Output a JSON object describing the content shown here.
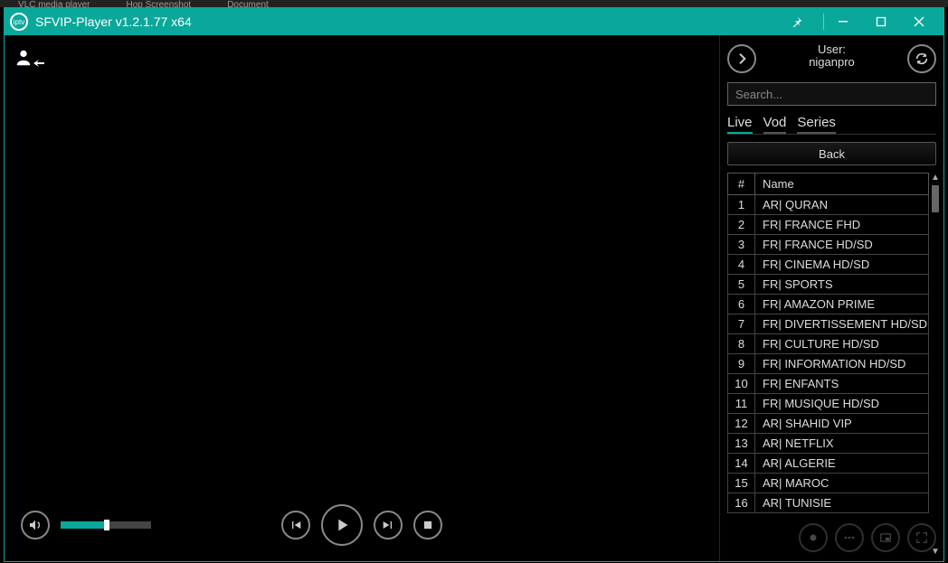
{
  "taskbar": {
    "items": [
      "VLC media player",
      "Hop Screenshot",
      "Document"
    ]
  },
  "window": {
    "title": "SFVIP-Player v1.2.1.77 x64"
  },
  "user": {
    "label": "User:",
    "name": "niganpro"
  },
  "search": {
    "placeholder": "Search..."
  },
  "tabs": {
    "live": "Live",
    "vod": "Vod",
    "series": "Series",
    "active": "live"
  },
  "back_label": "Back",
  "list": {
    "header_num": "#",
    "header_name": "Name",
    "rows": [
      {
        "n": "1",
        "name": "AR| QURAN"
      },
      {
        "n": "2",
        "name": "FR| FRANCE FHD"
      },
      {
        "n": "3",
        "name": "FR| FRANCE HD/SD"
      },
      {
        "n": "4",
        "name": "FR| CINEMA HD/SD"
      },
      {
        "n": "5",
        "name": "FR| SPORTS"
      },
      {
        "n": "6",
        "name": "FR| AMAZON PRIME"
      },
      {
        "n": "7",
        "name": "FR| DIVERTISSEMENT HD/SD"
      },
      {
        "n": "8",
        "name": "FR| CULTURE HD/SD"
      },
      {
        "n": "9",
        "name": "FR| INFORMATION HD/SD"
      },
      {
        "n": "10",
        "name": "FR| ENFANTS"
      },
      {
        "n": "11",
        "name": "FR| MUSIQUE HD/SD"
      },
      {
        "n": "12",
        "name": "AR| SHAHID VIP"
      },
      {
        "n": "13",
        "name": "AR| NETFLIX"
      },
      {
        "n": "14",
        "name": "AR| ALGERIE"
      },
      {
        "n": "15",
        "name": "AR| MAROC"
      },
      {
        "n": "16",
        "name": "AR| TUNISIE"
      }
    ]
  },
  "volume": {
    "percent": 48
  }
}
